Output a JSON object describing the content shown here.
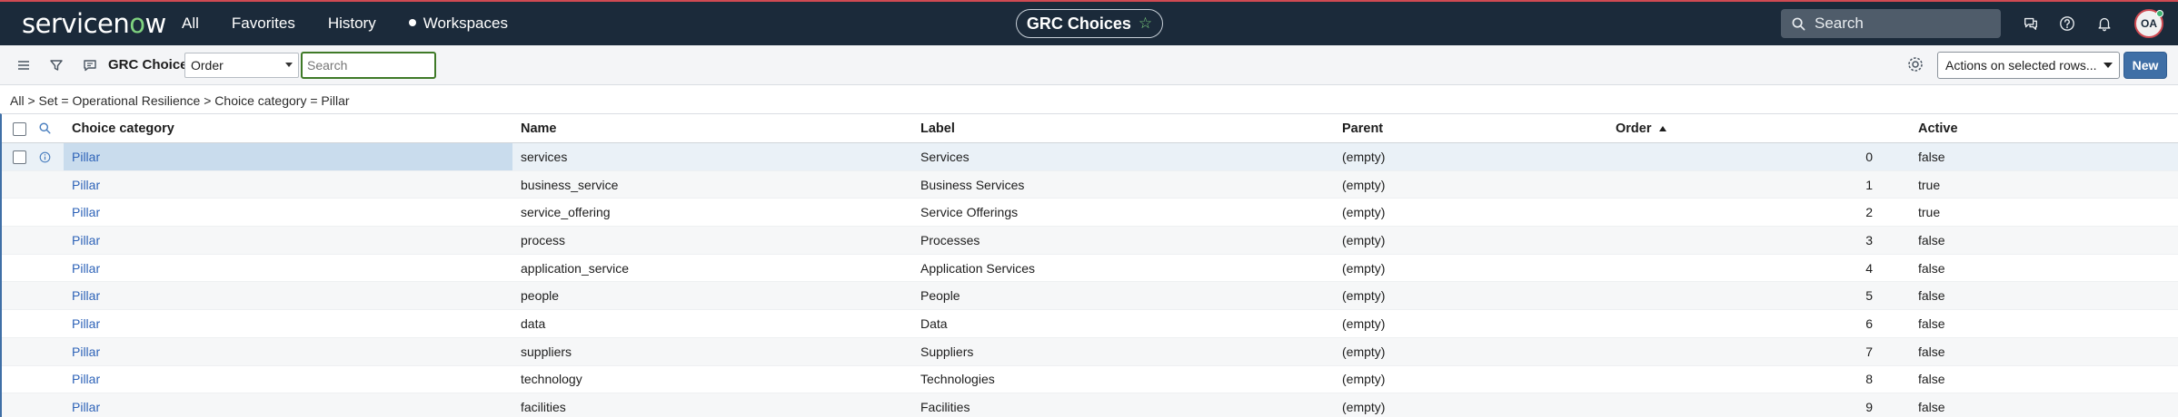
{
  "brand": {
    "logo_text_pre": "servicen",
    "logo_text_o": "o",
    "logo_text_post": "w"
  },
  "nav": {
    "links": [
      {
        "label": "All"
      },
      {
        "label": "Favorites"
      },
      {
        "label": "History"
      },
      {
        "label": "Workspaces"
      }
    ],
    "center_title": "GRC Choices",
    "search_label": "Search",
    "avatar_initials": "OA"
  },
  "toolbar": {
    "list_title": "GRC Choices",
    "order_select_value": "Order",
    "search_placeholder": "Search",
    "actions_select_value": "Actions on selected rows...",
    "new_label": "New"
  },
  "breadcrumb": "All > Set = Operational Resilience > Choice category = Pillar",
  "table": {
    "headers": {
      "category": "Choice category",
      "name": "Name",
      "label": "Label",
      "parent": "Parent",
      "order": "Order",
      "active": "Active"
    },
    "rows": [
      {
        "category": "Pillar",
        "name": "services",
        "label": "Services",
        "parent": "(empty)",
        "order": "0",
        "active": "false"
      },
      {
        "category": "Pillar",
        "name": "business_service",
        "label": "Business Services",
        "parent": "(empty)",
        "order": "1",
        "active": "true"
      },
      {
        "category": "Pillar",
        "name": "service_offering",
        "label": "Service Offerings",
        "parent": "(empty)",
        "order": "2",
        "active": "true"
      },
      {
        "category": "Pillar",
        "name": "process",
        "label": "Processes",
        "parent": "(empty)",
        "order": "3",
        "active": "false"
      },
      {
        "category": "Pillar",
        "name": "application_service",
        "label": "Application Services",
        "parent": "(empty)",
        "order": "4",
        "active": "false"
      },
      {
        "category": "Pillar",
        "name": "people",
        "label": "People",
        "parent": "(empty)",
        "order": "5",
        "active": "false"
      },
      {
        "category": "Pillar",
        "name": "data",
        "label": "Data",
        "parent": "(empty)",
        "order": "6",
        "active": "false"
      },
      {
        "category": "Pillar",
        "name": "suppliers",
        "label": "Suppliers",
        "parent": "(empty)",
        "order": "7",
        "active": "false"
      },
      {
        "category": "Pillar",
        "name": "technology",
        "label": "Technologies",
        "parent": "(empty)",
        "order": "8",
        "active": "false"
      },
      {
        "category": "Pillar",
        "name": "facilities",
        "label": "Facilities",
        "parent": "(empty)",
        "order": "9",
        "active": "false"
      }
    ]
  }
}
